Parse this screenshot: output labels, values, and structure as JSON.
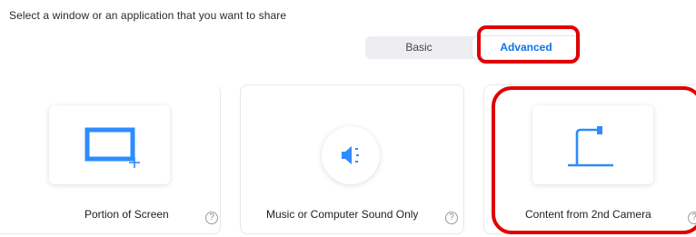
{
  "header": {
    "instruction": "Select a window or an application that you want to share"
  },
  "tabs": [
    {
      "label": "Basic",
      "selected": false
    },
    {
      "label": "Advanced",
      "selected": true
    }
  ],
  "options": [
    {
      "label": "Portion of Screen",
      "icon": "portion-screen-icon",
      "help": "?"
    },
    {
      "label": "Music or Computer Sound Only",
      "icon": "speaker-icon",
      "help": "?"
    },
    {
      "label": "Content from 2nd Camera",
      "icon": "document-camera-icon",
      "help": "?"
    }
  ],
  "colors": {
    "accent": "#0e71eb",
    "icon_blue": "#2d8cff",
    "annotation_red": "#e00000"
  }
}
